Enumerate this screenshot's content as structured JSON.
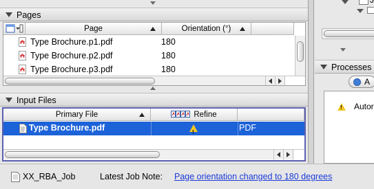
{
  "pages_panel": {
    "title": "Pages",
    "columns": [
      "Page",
      "Orientation (°)"
    ],
    "rows": [
      {
        "page": "Type Brochure.p1.pdf",
        "orientation": "180"
      },
      {
        "page": "Type Brochure.p2.pdf",
        "orientation": "180"
      },
      {
        "page": "Type Brochure.p3.pdf",
        "orientation": "180"
      }
    ]
  },
  "input_files_panel": {
    "title": "Input Files",
    "columns": [
      "Primary File",
      "Refine",
      ""
    ],
    "rows": [
      {
        "primary_file": "Type Brochure.pdf",
        "refine_status": "warning",
        "type": "PDF",
        "selected": true
      }
    ]
  },
  "processes_panel": {
    "title": "Processes",
    "button_label": "A",
    "item_label": "Autor"
  },
  "top_right_tree": {
    "item_label": "Jo"
  },
  "status_bar": {
    "job_name": "XX_RBA_Job",
    "latest_note_label": "Latest Job Note:",
    "latest_note_text": "Page orientation changed to 180 degrees"
  },
  "colors": {
    "selection": "#1c62d8",
    "link": "#1a3ad8",
    "focus_ring": "#5b5fb0",
    "warning": "#f3c623"
  }
}
